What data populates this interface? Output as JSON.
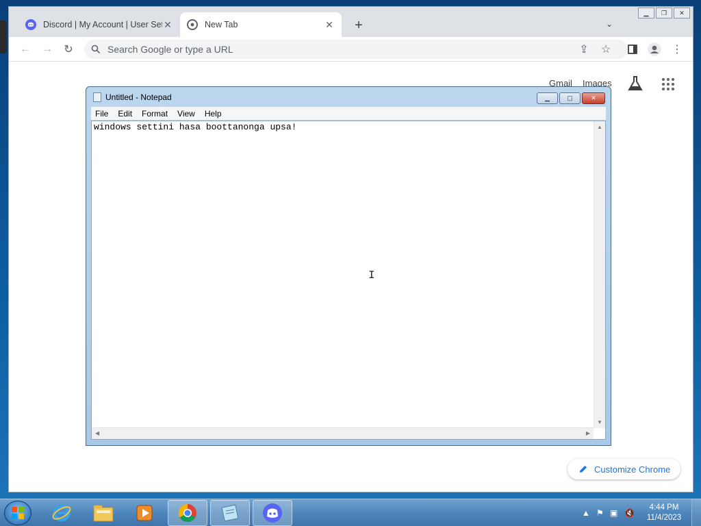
{
  "browser": {
    "tabs": [
      {
        "title": "Discord | My Account | User Settings",
        "active": false,
        "favicon": "discord-icon"
      },
      {
        "title": "New Tab",
        "active": true,
        "favicon": "chrome-icon"
      }
    ],
    "omnibox": {
      "placeholder": "Search Google or type a URL"
    },
    "ntp": {
      "gmail": "Gmail",
      "images": "Images",
      "customize": "Customize Chrome"
    }
  },
  "notepad": {
    "title": "Untitled - Notepad",
    "menu": [
      "File",
      "Edit",
      "Format",
      "View",
      "Help"
    ],
    "content": "windows settini hasa boottanonga upsa!"
  },
  "taskbar": {
    "apps": [
      "internet-explorer-icon",
      "file-explorer-icon",
      "media-player-icon",
      "chrome-icon",
      "notepad-icon",
      "discord-icon"
    ],
    "clock": {
      "time": "4:44 PM",
      "date": "11/4/2023"
    }
  },
  "colors": {
    "chrome_accent": "#1a73e8",
    "discord": "#5865f2",
    "taskbar": "#4f86bb"
  }
}
